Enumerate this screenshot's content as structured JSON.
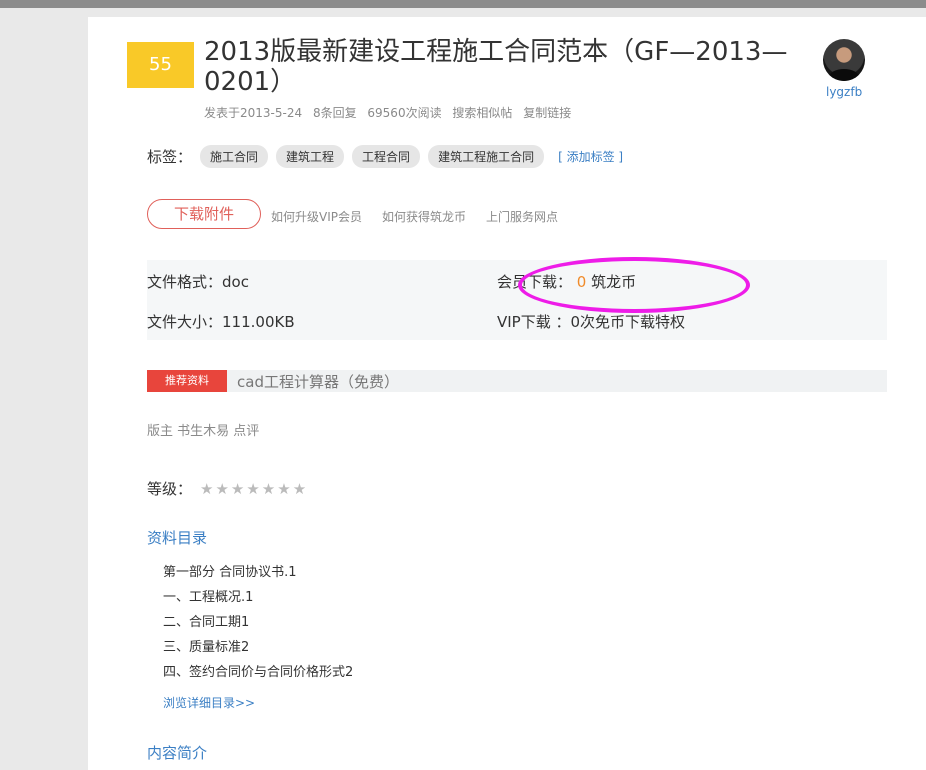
{
  "post": {
    "score": "55",
    "title": "2013版最新建设工程施工合同范本（GF—2013—0201）",
    "meta": {
      "posted": "发表于2013-5-24",
      "replies": "8条回复",
      "views": "69560次阅读",
      "search_similar": "搜索相似帖",
      "copy_link": "复制链接"
    },
    "author": "lygzfb"
  },
  "tags": {
    "label": "标签：",
    "items": [
      "施工合同",
      "建筑工程",
      "工程合同",
      "建筑工程施工合同"
    ],
    "add_label": "[ 添加标签 ]"
  },
  "download": {
    "button_label": "下载附件",
    "links": [
      "如何升级VIP会员",
      "如何获得筑龙币",
      "上门服务网点"
    ]
  },
  "file_info": {
    "format_label": "文件格式：",
    "format_value": "doc",
    "size_label": "文件大小：",
    "size_value": "111.00KB",
    "member_label": "会员下载：",
    "member_value": "0",
    "member_unit": "筑龙币",
    "vip_label": "VIP下载",
    "vip_value": "：0次免币下载特权",
    "highlight_color": "#ee1ce8"
  },
  "recommend": {
    "badge": "推荐资料",
    "text": "cad工程计算器（免费）"
  },
  "comment": "版主 书生木易 点评",
  "rating": {
    "label": "等级：",
    "stars": "★★★★★★★",
    "filled_stars": 0,
    "total_stars": 7
  },
  "toc": {
    "title": "资料目录",
    "items": [
      "第一部分 合同协议书.1",
      "一、工程概况.1",
      "二、合同工期1",
      "三、质量标准2",
      "四、签约合同价与合同价格形式2"
    ],
    "more": "浏览详细目录>>"
  },
  "summary": {
    "title": "内容简介"
  },
  "colors": {
    "accent_blue": "#3b7fc4",
    "badge_yellow": "#f9c928",
    "download_red": "#e0605a",
    "recommend_red": "#e8453c",
    "orange": "#f08b2a"
  }
}
